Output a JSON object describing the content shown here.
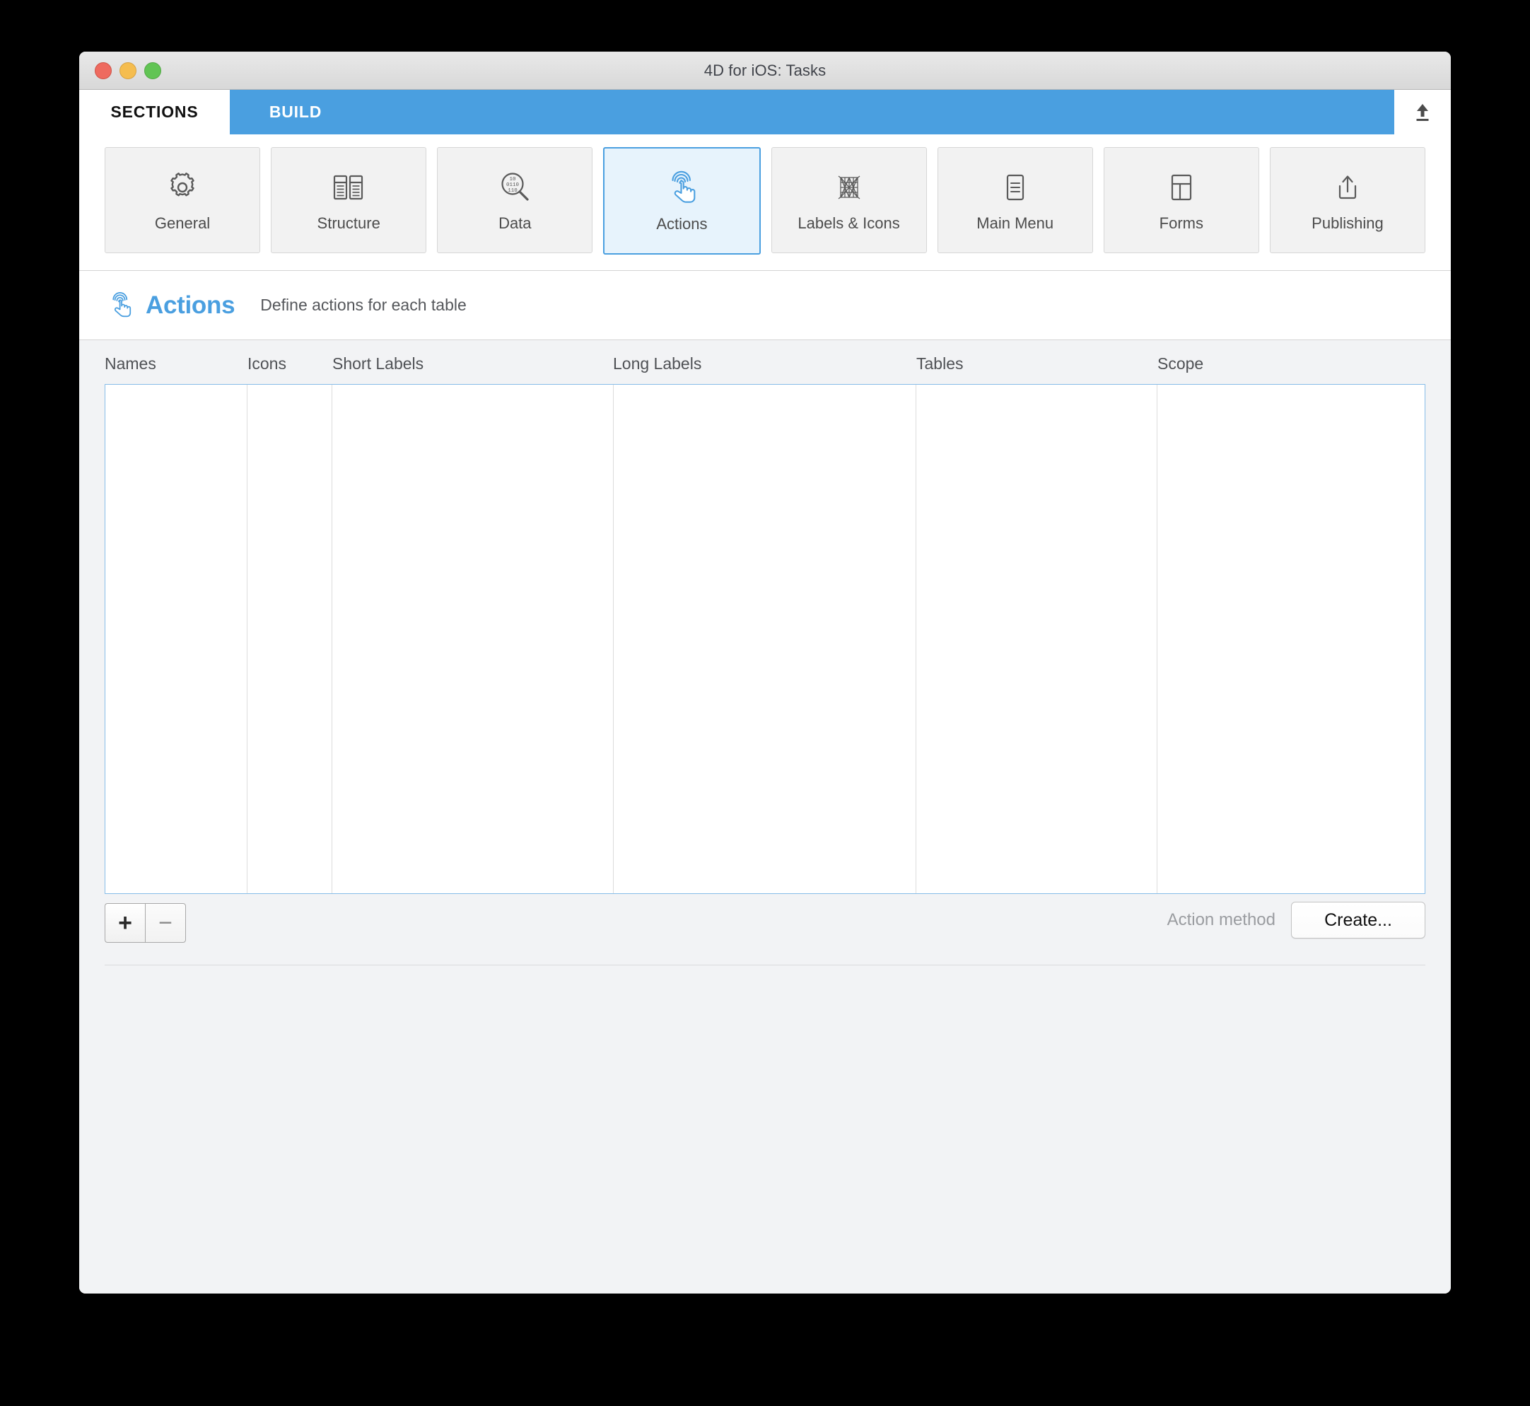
{
  "window": {
    "title": "4D for iOS: Tasks",
    "traffic_lights": [
      "close-button",
      "minimize-button",
      "maximize-button"
    ]
  },
  "tabs": [
    {
      "label": "SECTIONS",
      "active": true
    },
    {
      "label": "BUILD",
      "active": false
    }
  ],
  "export_icon": "upload-icon",
  "section_toolbar": {
    "items": [
      {
        "label": "General",
        "icon": "gear-icon",
        "selected": false
      },
      {
        "label": "Structure",
        "icon": "tables-icon",
        "selected": false
      },
      {
        "label": "Data",
        "icon": "binary-search-icon",
        "selected": false
      },
      {
        "label": "Actions",
        "icon": "tap-finger-icon",
        "selected": true
      },
      {
        "label": "Labels & Icons",
        "icon": "grid-mesh-icon",
        "selected": false
      },
      {
        "label": "Main Menu",
        "icon": "menu-list-icon",
        "selected": false
      },
      {
        "label": "Forms",
        "icon": "layout-panes-icon",
        "selected": false
      },
      {
        "label": "Publishing",
        "icon": "upload-tray-icon",
        "selected": false
      }
    ]
  },
  "page_header": {
    "icon": "tap-finger-icon",
    "title": "Actions",
    "subtitle": "Define actions for each table"
  },
  "table": {
    "columns": [
      {
        "label": "Names"
      },
      {
        "label": "Icons"
      },
      {
        "label": "Short Labels"
      },
      {
        "label": "Long Labels"
      },
      {
        "label": "Tables"
      },
      {
        "label": "Scope"
      }
    ],
    "rows": []
  },
  "bottom_bar": {
    "add_label": "+",
    "remove_label": "−",
    "action_method_label": "Action method",
    "create_label": "Create..."
  },
  "colors": {
    "accent_blue": "#4a9fe0",
    "selected_fill": "#e7f3fc",
    "window_bg": "#f2f3f5",
    "grid_border": "#86bce8",
    "text_dark": "#4f5155",
    "text_muted": "#9a9ca0"
  }
}
